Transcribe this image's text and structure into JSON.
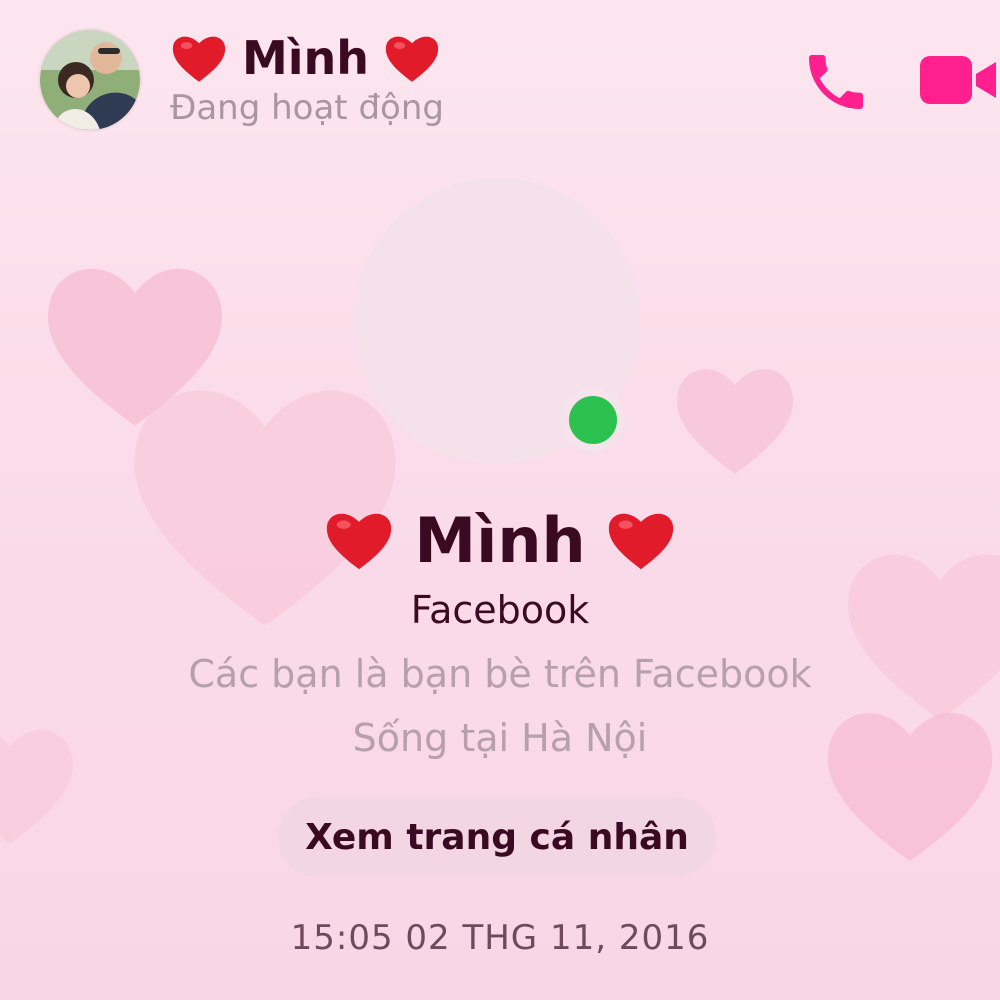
{
  "header": {
    "contact_name": "Mình",
    "status": "Đang hoạt động",
    "avatar": "profile-photo",
    "call_icon": "phone-icon",
    "video_icon": "video-camera-icon"
  },
  "profile": {
    "name": "Mình",
    "platform": "Facebook",
    "friendship": "Các bạn là bạn bè trên Facebook",
    "location": "Sống tại Hà Nội",
    "view_profile_label": "Xem trang cá nhân",
    "online": true
  },
  "timestamp": "15:05 02 THG 11, 2016",
  "colors": {
    "accent": "#ff1f8f",
    "online": "#2dc14f",
    "text_dark": "#3a0a22",
    "text_muted": "#b5a0ab",
    "heart": "#e21b2b"
  }
}
